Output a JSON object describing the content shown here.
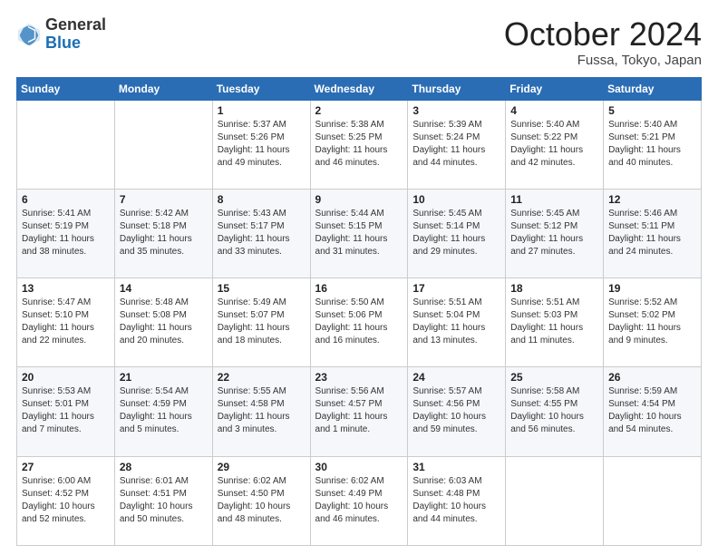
{
  "logo": {
    "general": "General",
    "blue": "Blue"
  },
  "header": {
    "month": "October 2024",
    "location": "Fussa, Tokyo, Japan"
  },
  "weekdays": [
    "Sunday",
    "Monday",
    "Tuesday",
    "Wednesday",
    "Thursday",
    "Friday",
    "Saturday"
  ],
  "weeks": [
    [
      {
        "day": "",
        "info": ""
      },
      {
        "day": "",
        "info": ""
      },
      {
        "day": "1",
        "info": "Sunrise: 5:37 AM\nSunset: 5:26 PM\nDaylight: 11 hours and 49 minutes."
      },
      {
        "day": "2",
        "info": "Sunrise: 5:38 AM\nSunset: 5:25 PM\nDaylight: 11 hours and 46 minutes."
      },
      {
        "day": "3",
        "info": "Sunrise: 5:39 AM\nSunset: 5:24 PM\nDaylight: 11 hours and 44 minutes."
      },
      {
        "day": "4",
        "info": "Sunrise: 5:40 AM\nSunset: 5:22 PM\nDaylight: 11 hours and 42 minutes."
      },
      {
        "day": "5",
        "info": "Sunrise: 5:40 AM\nSunset: 5:21 PM\nDaylight: 11 hours and 40 minutes."
      }
    ],
    [
      {
        "day": "6",
        "info": "Sunrise: 5:41 AM\nSunset: 5:19 PM\nDaylight: 11 hours and 38 minutes."
      },
      {
        "day": "7",
        "info": "Sunrise: 5:42 AM\nSunset: 5:18 PM\nDaylight: 11 hours and 35 minutes."
      },
      {
        "day": "8",
        "info": "Sunrise: 5:43 AM\nSunset: 5:17 PM\nDaylight: 11 hours and 33 minutes."
      },
      {
        "day": "9",
        "info": "Sunrise: 5:44 AM\nSunset: 5:15 PM\nDaylight: 11 hours and 31 minutes."
      },
      {
        "day": "10",
        "info": "Sunrise: 5:45 AM\nSunset: 5:14 PM\nDaylight: 11 hours and 29 minutes."
      },
      {
        "day": "11",
        "info": "Sunrise: 5:45 AM\nSunset: 5:12 PM\nDaylight: 11 hours and 27 minutes."
      },
      {
        "day": "12",
        "info": "Sunrise: 5:46 AM\nSunset: 5:11 PM\nDaylight: 11 hours and 24 minutes."
      }
    ],
    [
      {
        "day": "13",
        "info": "Sunrise: 5:47 AM\nSunset: 5:10 PM\nDaylight: 11 hours and 22 minutes."
      },
      {
        "day": "14",
        "info": "Sunrise: 5:48 AM\nSunset: 5:08 PM\nDaylight: 11 hours and 20 minutes."
      },
      {
        "day": "15",
        "info": "Sunrise: 5:49 AM\nSunset: 5:07 PM\nDaylight: 11 hours and 18 minutes."
      },
      {
        "day": "16",
        "info": "Sunrise: 5:50 AM\nSunset: 5:06 PM\nDaylight: 11 hours and 16 minutes."
      },
      {
        "day": "17",
        "info": "Sunrise: 5:51 AM\nSunset: 5:04 PM\nDaylight: 11 hours and 13 minutes."
      },
      {
        "day": "18",
        "info": "Sunrise: 5:51 AM\nSunset: 5:03 PM\nDaylight: 11 hours and 11 minutes."
      },
      {
        "day": "19",
        "info": "Sunrise: 5:52 AM\nSunset: 5:02 PM\nDaylight: 11 hours and 9 minutes."
      }
    ],
    [
      {
        "day": "20",
        "info": "Sunrise: 5:53 AM\nSunset: 5:01 PM\nDaylight: 11 hours and 7 minutes."
      },
      {
        "day": "21",
        "info": "Sunrise: 5:54 AM\nSunset: 4:59 PM\nDaylight: 11 hours and 5 minutes."
      },
      {
        "day": "22",
        "info": "Sunrise: 5:55 AM\nSunset: 4:58 PM\nDaylight: 11 hours and 3 minutes."
      },
      {
        "day": "23",
        "info": "Sunrise: 5:56 AM\nSunset: 4:57 PM\nDaylight: 11 hours and 1 minute."
      },
      {
        "day": "24",
        "info": "Sunrise: 5:57 AM\nSunset: 4:56 PM\nDaylight: 10 hours and 59 minutes."
      },
      {
        "day": "25",
        "info": "Sunrise: 5:58 AM\nSunset: 4:55 PM\nDaylight: 10 hours and 56 minutes."
      },
      {
        "day": "26",
        "info": "Sunrise: 5:59 AM\nSunset: 4:54 PM\nDaylight: 10 hours and 54 minutes."
      }
    ],
    [
      {
        "day": "27",
        "info": "Sunrise: 6:00 AM\nSunset: 4:52 PM\nDaylight: 10 hours and 52 minutes."
      },
      {
        "day": "28",
        "info": "Sunrise: 6:01 AM\nSunset: 4:51 PM\nDaylight: 10 hours and 50 minutes."
      },
      {
        "day": "29",
        "info": "Sunrise: 6:02 AM\nSunset: 4:50 PM\nDaylight: 10 hours and 48 minutes."
      },
      {
        "day": "30",
        "info": "Sunrise: 6:02 AM\nSunset: 4:49 PM\nDaylight: 10 hours and 46 minutes."
      },
      {
        "day": "31",
        "info": "Sunrise: 6:03 AM\nSunset: 4:48 PM\nDaylight: 10 hours and 44 minutes."
      },
      {
        "day": "",
        "info": ""
      },
      {
        "day": "",
        "info": ""
      }
    ]
  ]
}
